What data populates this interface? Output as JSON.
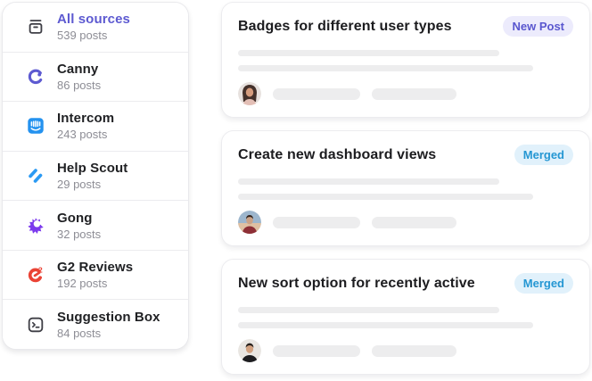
{
  "page": {
    "background": "#ffffff",
    "accent_purple": "#5d5ad1",
    "skeleton_color": "#ededee"
  },
  "sidebar": {
    "items": [
      {
        "label": "All sources",
        "count": "539 posts",
        "icon": "archive-icon",
        "active": true
      },
      {
        "label": "Canny",
        "count": "86 posts",
        "icon": "canny-icon",
        "active": false
      },
      {
        "label": "Intercom",
        "count": "243 posts",
        "icon": "intercom-icon",
        "active": false
      },
      {
        "label": "Help Scout",
        "count": "29 posts",
        "icon": "helpscout-icon",
        "active": false
      },
      {
        "label": "Gong",
        "count": "32 posts",
        "icon": "gong-icon",
        "active": false
      },
      {
        "label": "G2 Reviews",
        "count": "192 posts",
        "icon": "g2-icon",
        "active": false
      },
      {
        "label": "Suggestion Box",
        "count": "84 posts",
        "icon": "terminal-icon",
        "active": false
      }
    ]
  },
  "posts": [
    {
      "title": "Badges for different user types",
      "badge": {
        "label": "New Post",
        "bg": "#ecebfc",
        "color": "#5a57cf"
      },
      "avatar": "avatar-woman"
    },
    {
      "title": "Create new dashboard views",
      "badge": {
        "label": "Merged",
        "bg": "#e1f1fb",
        "color": "#2597d3"
      },
      "avatar": "avatar-man-red-shirt"
    },
    {
      "title": "New sort option for recently active",
      "badge": {
        "label": "Merged",
        "bg": "#e1f1fb",
        "color": "#2597d3"
      },
      "avatar": "avatar-man-dark-shirt"
    }
  ]
}
